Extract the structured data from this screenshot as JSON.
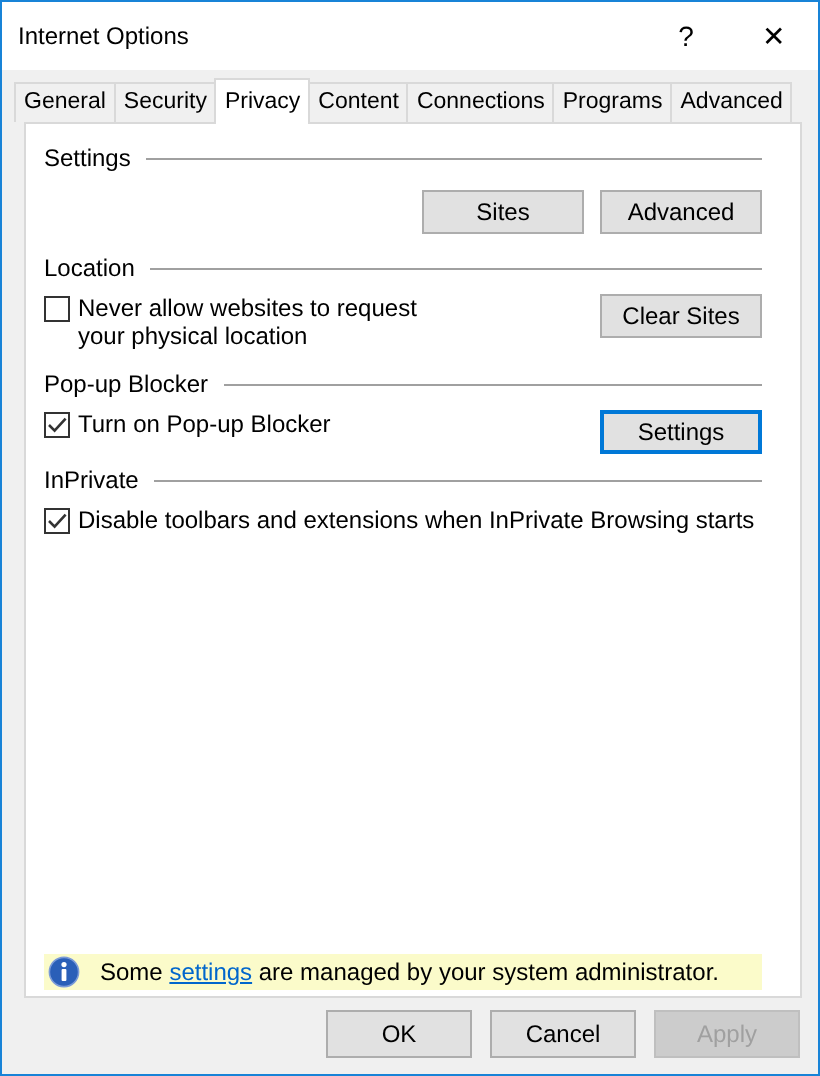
{
  "window": {
    "title": "Internet Options",
    "help": "?",
    "close": "✕"
  },
  "tabs": [
    {
      "label": "General",
      "selected": false
    },
    {
      "label": "Security",
      "selected": false
    },
    {
      "label": "Privacy",
      "selected": true
    },
    {
      "label": "Content",
      "selected": false
    },
    {
      "label": "Connections",
      "selected": false
    },
    {
      "label": "Programs",
      "selected": false
    },
    {
      "label": "Advanced",
      "selected": false
    }
  ],
  "sections": [
    {
      "title": "Settings",
      "buttons": [
        {
          "label": "Sites",
          "focused": false
        },
        {
          "label": "Advanced",
          "focused": false
        }
      ]
    },
    {
      "title": "Location",
      "checkbox": {
        "label": "Never allow websites to request your physical location",
        "checked": false
      },
      "buttons": [
        {
          "label": "Clear Sites",
          "focused": false
        }
      ]
    },
    {
      "title": "Pop-up Blocker",
      "checkbox": {
        "label": "Turn on Pop-up Blocker",
        "checked": true
      },
      "buttons": [
        {
          "label": "Settings",
          "focused": true
        }
      ]
    },
    {
      "title": "InPrivate",
      "checkbox": {
        "label": "Disable toolbars and extensions when InPrivate Browsing starts",
        "checked": true
      }
    }
  ],
  "notice": {
    "before": "Some ",
    "link": "settings",
    "after": " are managed by your system administrator."
  },
  "buttons": [
    {
      "label": "OK",
      "disabled": false
    },
    {
      "label": "Cancel",
      "disabled": false
    },
    {
      "label": "Apply",
      "disabled": true
    }
  ]
}
